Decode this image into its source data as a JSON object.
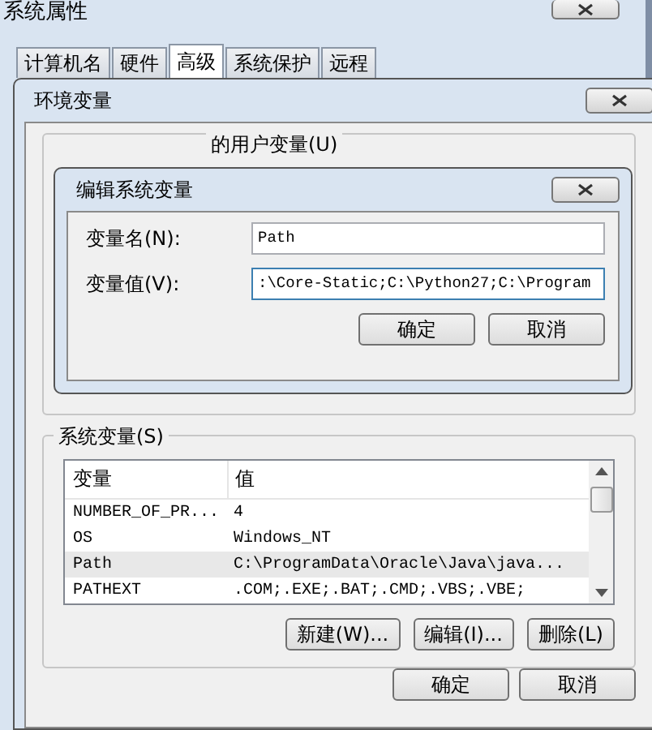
{
  "window": {
    "title": "系统属性"
  },
  "tabs": [
    {
      "label": "计算机名",
      "selected": false
    },
    {
      "label": "硬件",
      "selected": false
    },
    {
      "label": "高级",
      "selected": true
    },
    {
      "label": "系统保护",
      "selected": false
    },
    {
      "label": "远程",
      "selected": false
    }
  ],
  "env_dialog": {
    "title": "环境变量",
    "user_vars_label": "的用户变量(U)",
    "system_vars": {
      "label": "系统变量(S)",
      "columns": [
        "变量",
        "值"
      ],
      "rows": [
        {
          "name": "NUMBER_OF_PR...",
          "value": "4",
          "selected": false
        },
        {
          "name": "OS",
          "value": "Windows_NT",
          "selected": false
        },
        {
          "name": "Path",
          "value": "C:\\ProgramData\\Oracle\\Java\\java...",
          "selected": true
        },
        {
          "name": "PATHEXT",
          "value": ".COM;.EXE;.BAT;.CMD;.VBS;.VBE;",
          "selected": false
        }
      ],
      "buttons": [
        "新建(W)...",
        "编辑(I)...",
        "删除(L)"
      ]
    },
    "buttons": [
      "确定",
      "取消"
    ]
  },
  "edit_dialog": {
    "title": "编辑系统变量",
    "fields": [
      {
        "label": "变量名(N):",
        "value": "Path"
      },
      {
        "label": "变量值(V):",
        "value": ":\\Core-Static;C:\\Python27;C:\\Program"
      }
    ],
    "buttons": [
      "确定",
      "取消"
    ]
  }
}
